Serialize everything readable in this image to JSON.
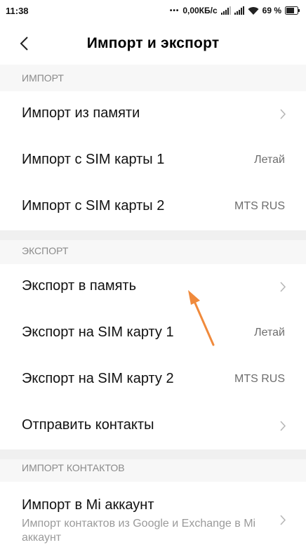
{
  "status": {
    "time": "11:38",
    "dots": "•••",
    "network_speed": "0,00КБ/с",
    "battery_percent": "69 %"
  },
  "header": {
    "title": "Импорт и экспорт"
  },
  "sections": {
    "import": {
      "header": "ИМПОРТ",
      "items": [
        {
          "label": "Импорт из памяти",
          "value": ""
        },
        {
          "label": "Импорт с SIM карты 1",
          "value": "Летай"
        },
        {
          "label": "Импорт с SIM карты 2",
          "value": "MTS RUS"
        }
      ]
    },
    "export": {
      "header": "ЭКСПОРТ",
      "items": [
        {
          "label": "Экспорт в память",
          "value": ""
        },
        {
          "label": "Экспорт на SIM карту 1",
          "value": "Летай"
        },
        {
          "label": "Экспорт на SIM карту 2",
          "value": "MTS RUS"
        },
        {
          "label": "Отправить контакты",
          "value": ""
        }
      ]
    },
    "import_contacts": {
      "header": "ИМПОРТ КОНТАКТОВ",
      "items": [
        {
          "label": "Импорт в Mi аккаунт",
          "subtitle": "Импорт контактов из Google и Exchange в Mi аккаунт"
        }
      ]
    }
  },
  "colors": {
    "annotation_arrow": "#f08a3c",
    "section_bg": "#f7f7f7"
  },
  "icons": [
    "back-icon",
    "chevron-right-icon",
    "signal-icon",
    "wifi-icon",
    "battery-icon"
  ]
}
